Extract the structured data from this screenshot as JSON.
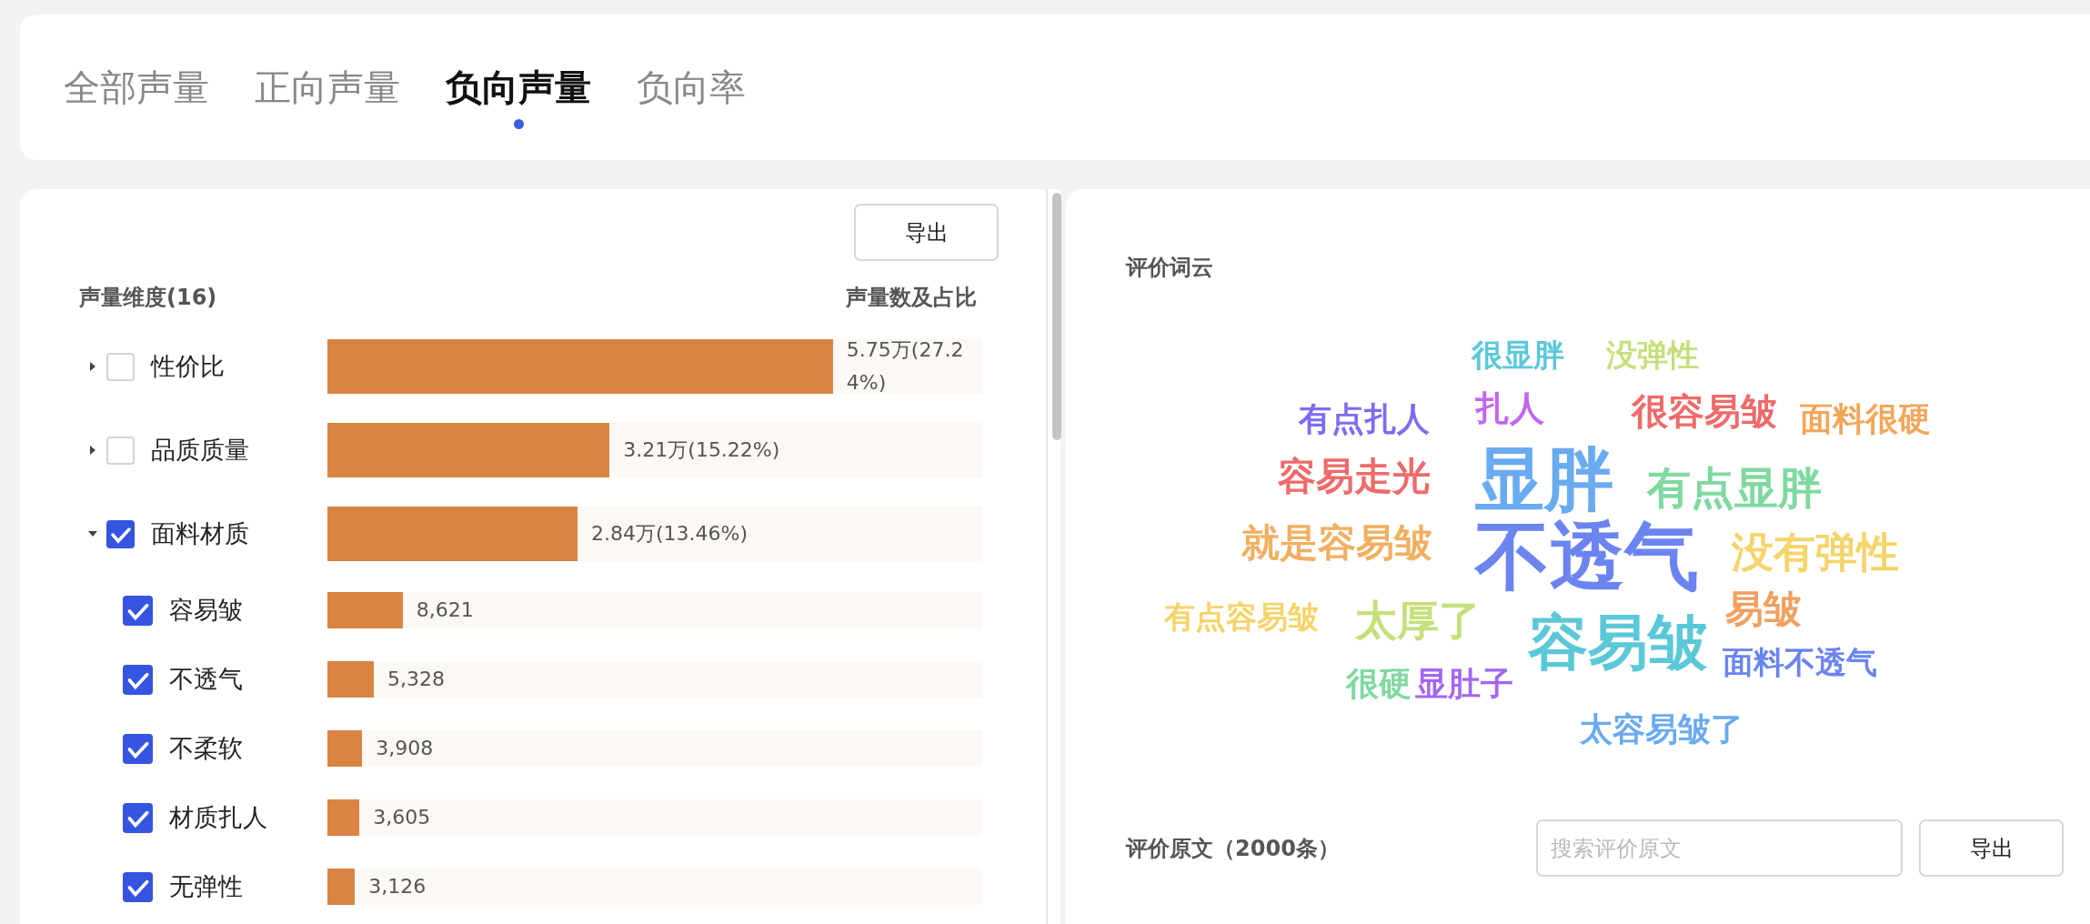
{
  "tabs": [
    {
      "label": "全部声量",
      "selected": false
    },
    {
      "label": "正向声量",
      "selected": false
    },
    {
      "label": "负向声量",
      "selected": true
    },
    {
      "label": "负向率",
      "selected": false
    }
  ],
  "dimension_panel": {
    "export_button": "导出",
    "header_left": "声量维度(16)",
    "header_right": "声量数及占比",
    "rows": [
      {
        "label": "性价比",
        "checked": false,
        "expanded": false,
        "level": 0.772,
        "value": "5.75万(27.24%)"
      },
      {
        "label": "品质质量",
        "checked": false,
        "expanded": false,
        "level": 0.431,
        "value": "3.21万(15.22%)"
      },
      {
        "label": "面料材质",
        "checked": true,
        "expanded": true,
        "level": 0.382,
        "value": "2.84万(13.46%)",
        "children": [
          {
            "label": "容易皱",
            "checked": true,
            "level": 0.115,
            "value": "8,621"
          },
          {
            "label": "不透气",
            "checked": true,
            "level": 0.071,
            "value": "5,328"
          },
          {
            "label": "不柔软",
            "checked": true,
            "level": 0.053,
            "value": "3,908"
          },
          {
            "label": "材质扎人",
            "checked": true,
            "level": 0.049,
            "value": "3,605"
          },
          {
            "label": "无弹性",
            "checked": true,
            "level": 0.042,
            "value": "3,126"
          }
        ]
      }
    ]
  },
  "word_cloud": {
    "title": "评价词云",
    "words": [
      {
        "text": "很显胖",
        "color": "#5bc8d8"
      },
      {
        "text": "没弹性",
        "color": "#c5e07a"
      },
      {
        "text": "有点扎人",
        "color": "#7b6cf0"
      },
      {
        "text": "扎人",
        "color": "#c266f0"
      },
      {
        "text": "很容易皱",
        "color": "#ef6a6a"
      },
      {
        "text": "面料很硬",
        "color": "#f2a65a"
      },
      {
        "text": "容易走光",
        "color": "#ee6b6b"
      },
      {
        "text": "显胖",
        "color": "#6aaaf0"
      },
      {
        "text": "有点显胖",
        "color": "#7fd9a0"
      },
      {
        "text": "就是容易皱",
        "color": "#f0b060"
      },
      {
        "text": "不透气",
        "color": "#6b84f0"
      },
      {
        "text": "没有弹性",
        "color": "#f5d46a"
      },
      {
        "text": "有点容易皱",
        "color": "#f5d46a"
      },
      {
        "text": "太厚了",
        "color": "#c5e07a"
      },
      {
        "text": "容易皱",
        "color": "#5bc8d8"
      },
      {
        "text": "易皱",
        "color": "#f0a060"
      },
      {
        "text": "很硬",
        "color": "#7fd9a0"
      },
      {
        "text": "显肚子",
        "color": "#a466f0"
      },
      {
        "text": "面料不透气",
        "color": "#6b84f0"
      },
      {
        "text": "太容易皱了",
        "color": "#6aaaf0"
      }
    ]
  },
  "reviews": {
    "title": "评价原文（2000条）",
    "search": {
      "placeholder": "搜索评价原文"
    },
    "export_button": "导出"
  }
}
